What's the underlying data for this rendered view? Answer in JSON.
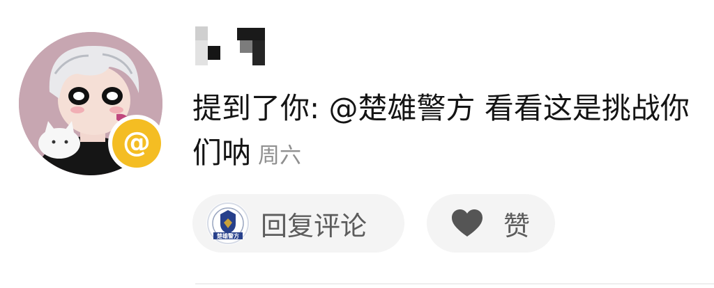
{
  "comment": {
    "text": "提到了你: @楚雄警方 看看这是挑战你们呐",
    "time": "周六"
  },
  "actions": {
    "reply_label": "回复评论",
    "like_label": "赞"
  },
  "icons": {
    "mention_badge": "at-icon",
    "mention_glyph": "@",
    "like": "heart-icon",
    "reply_account": "police-seal-avatar"
  },
  "seal": {
    "lettering": "楚雄警方"
  },
  "colors": {
    "badge": "#f4bd23",
    "pill_background": "#f4f4f4",
    "time_text": "#8f8f8f"
  }
}
